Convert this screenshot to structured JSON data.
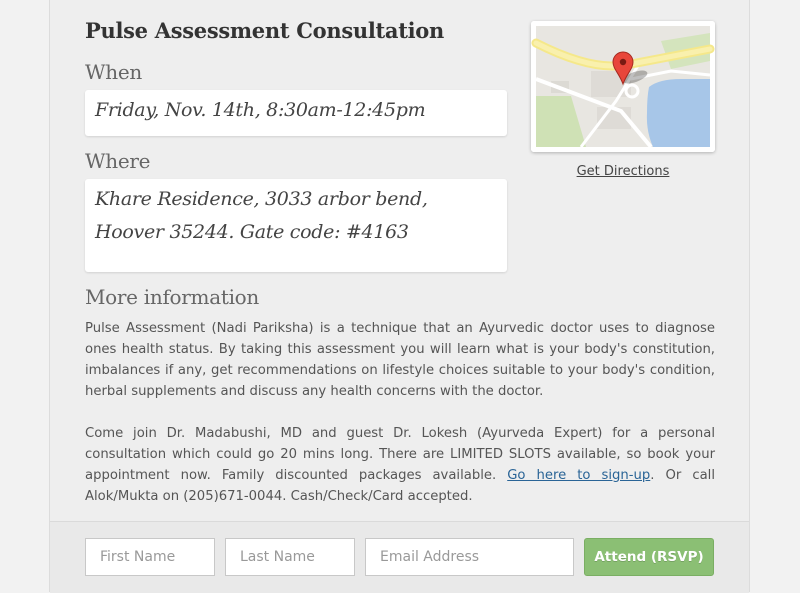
{
  "event": {
    "title": "Pulse Assessment Consultation",
    "when_label": "When",
    "when_value": "Friday, Nov. 14th, 8:30am-12:45pm",
    "where_label": "Where",
    "where_line1": "Khare Residence, 3033 arbor bend,",
    "where_line2": "Hoover 35244. Gate code: #4163",
    "more_label": "More information",
    "info_p1": "Pulse Assessment (Nadi Pariksha) is a technique that an Ayurvedic doctor uses to diagnose ones health status. By taking this assessment you will learn what is your body's constitution, imbalances if any, get recommendations on lifestyle choices suitable to your body's condition, herbal supplements and discuss any health concerns with the doctor.",
    "info_p2_before": "Come join Dr. Madabushi, MD and guest Dr. Lokesh (Ayurveda Expert) for a personal consultation which could go 20 mins long. There are LIMITED SLOTS available, so book your appointment now. Family discounted packages available. ",
    "info_p2_link": "Go here to sign-up",
    "info_p2_after": ". Or call Alok/Mukta on (205)671-0044. Cash/Check/Card accepted."
  },
  "map": {
    "directions_label": "Get Directions",
    "icon": "map-pin-icon"
  },
  "rsvp": {
    "first_name_placeholder": "First Name",
    "last_name_placeholder": "Last Name",
    "email_placeholder": "Email Address",
    "button_label": "Attend (RSVP)"
  },
  "colors": {
    "button": "#8bbf74",
    "link": "#2a6496",
    "pin": "#e8463a"
  }
}
